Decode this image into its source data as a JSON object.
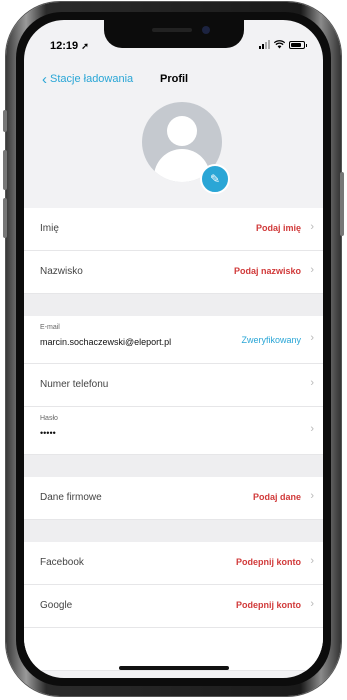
{
  "status_bar": {
    "time": "12:19",
    "location_glyph": "➚"
  },
  "nav": {
    "back_label": "Stacje ładowania",
    "title": "Profil"
  },
  "profile": {
    "avatar_icon": "person-silhouette-icon",
    "edit_icon": "pencil-icon",
    "edit_glyph": "✎"
  },
  "rows": {
    "first_name": {
      "label": "Imię",
      "action": "Podaj imię"
    },
    "last_name": {
      "label": "Nazwisko",
      "action": "Podaj nazwisko"
    },
    "email": {
      "label": "E-mail",
      "value": "marcin.sochaczewski@eleport.pl",
      "action": "Zweryfikowany"
    },
    "phone": {
      "label": "Numer telefonu"
    },
    "password": {
      "label": "Hasło",
      "value": "•••••"
    },
    "company": {
      "label": "Dane firmowe",
      "action": "Podaj dane"
    },
    "facebook": {
      "label": "Facebook",
      "action": "Podepnij konto"
    },
    "google": {
      "label": "Google",
      "action": "Podepnij konto"
    }
  },
  "colors": {
    "accent": "#2aa6d6",
    "warning": "#d13a3a",
    "background": "#f2f2f4"
  }
}
